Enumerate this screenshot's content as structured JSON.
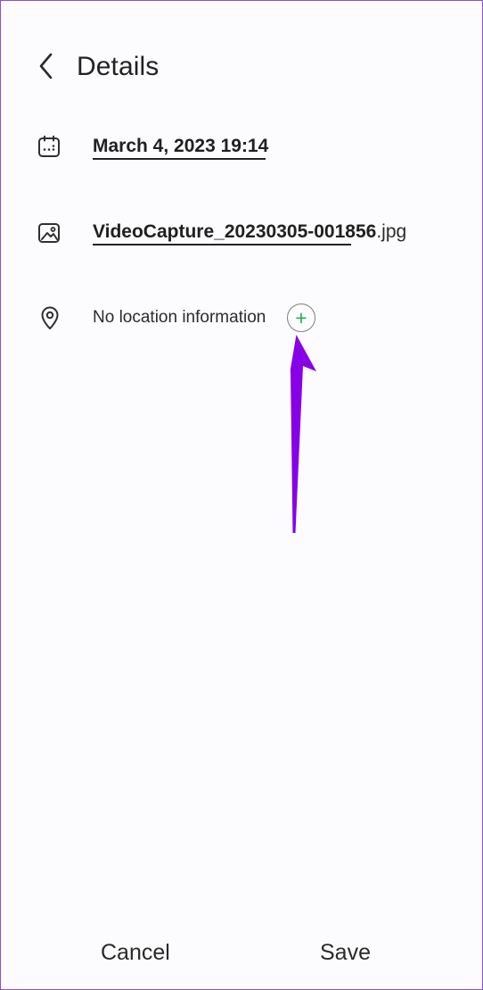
{
  "header": {
    "title": "Details"
  },
  "details": {
    "date_time": "March 4, 2023 19:14",
    "filename_base": "VideoCapture_20230305-001856",
    "filename_extension": ".jpg",
    "location_text": "No location information"
  },
  "actions": {
    "cancel": "Cancel",
    "save": "Save"
  },
  "icons": {
    "back": "chevron-left-icon",
    "date": "calendar-icon",
    "image": "image-icon",
    "location": "location-pin-icon",
    "add": "plus-icon",
    "annotation": "arrow-up-icon"
  },
  "colors": {
    "accent_purple": "#8700e8",
    "plus_green": "#29b14d",
    "text_dark": "#262626"
  }
}
